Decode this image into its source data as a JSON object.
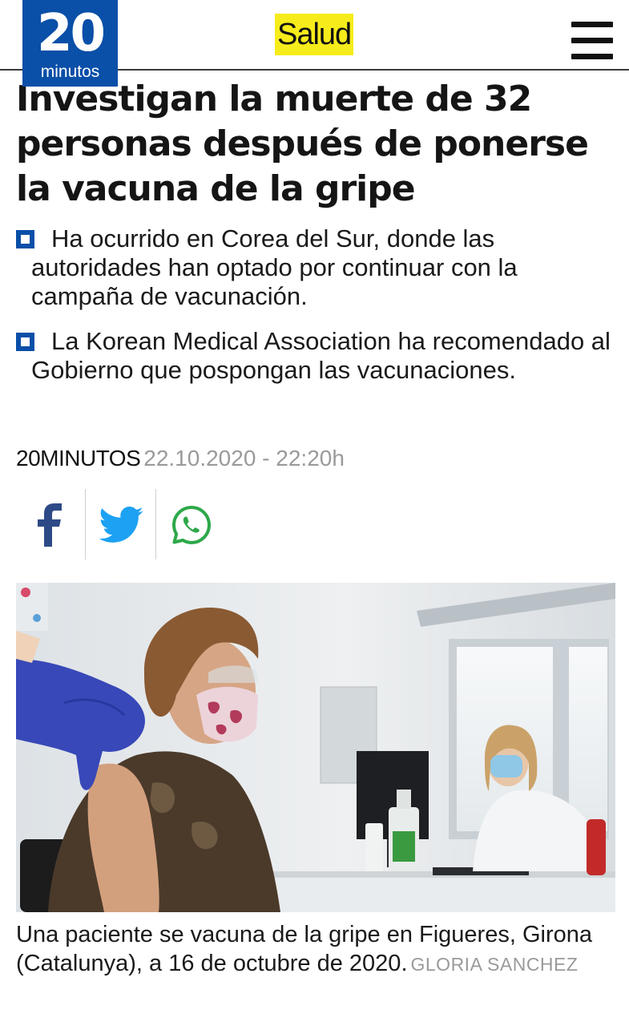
{
  "header": {
    "logo_number": "20",
    "logo_word": "minutos",
    "section": "Salud",
    "brand_color": "#0a4fa8",
    "section_highlight": "#f7ec1b",
    "menu_icon": "hamburger-menu-icon"
  },
  "article": {
    "headline": "Investigan la muerte de 32 personas después de ponerse la vacuna de la gripe",
    "bullets": [
      "Ha ocurrido en Corea del Sur, donde las autoridades han optado por continuar con la campaña de vacunación.",
      "La Korean Medical Association ha recomendado al Gobierno que pospongan las vacunaciones."
    ],
    "author": "20MINUTOS",
    "datetime": "22.10.2020 - 22:20h"
  },
  "share": {
    "icons": [
      "facebook-icon",
      "twitter-icon",
      "whatsapp-icon"
    ],
    "facebook_color": "#2d4a86",
    "twitter_color": "#1da1f2",
    "whatsapp_color": "#2ea84a"
  },
  "photo": {
    "caption": "Una paciente se vacuna de la gripe en Figueres, Girona (Catalunya), a 16 de octubre de 2020.",
    "credit": "GLORIA SANCHEZ"
  }
}
